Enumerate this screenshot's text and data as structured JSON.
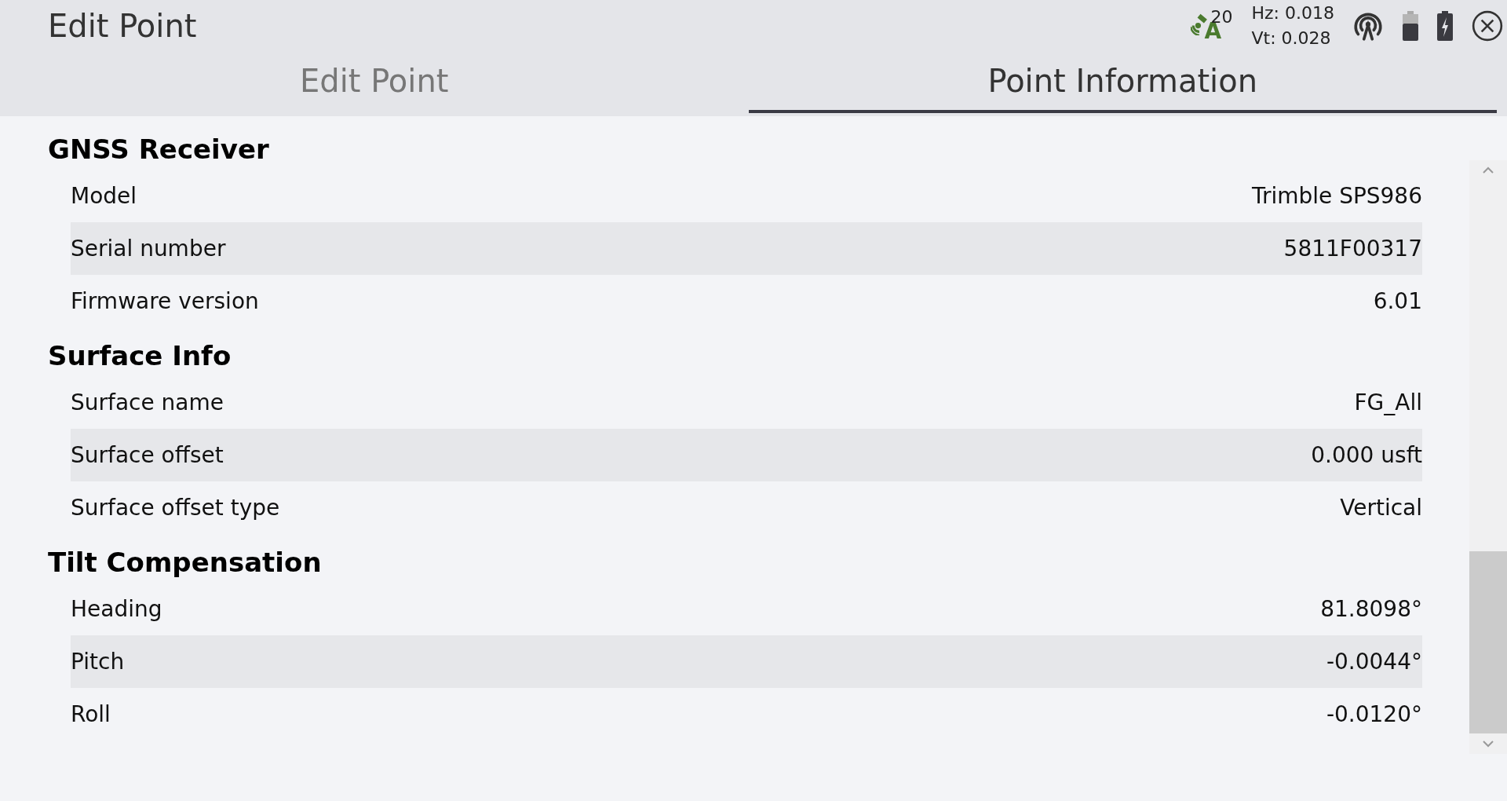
{
  "window": {
    "title": "Edit Point"
  },
  "status": {
    "satellites": "20",
    "mode": "A",
    "hz": "Hz: 0.018",
    "vt": "Vt: 0.028"
  },
  "tabs": [
    {
      "label": "Edit Point",
      "selected": false
    },
    {
      "label": "Point Information",
      "selected": true
    }
  ],
  "sections": [
    {
      "title": "GNSS Receiver",
      "rows": [
        {
          "label": "Model",
          "value": "Trimble SPS986"
        },
        {
          "label": "Serial number",
          "value": "5811F00317"
        },
        {
          "label": "Firmware version",
          "value": "6.01"
        }
      ]
    },
    {
      "title": "Surface Info",
      "rows": [
        {
          "label": "Surface name",
          "value": "FG_All"
        },
        {
          "label": "Surface offset",
          "value": "0.000 usft"
        },
        {
          "label": "Surface offset type",
          "value": "Vertical"
        }
      ]
    },
    {
      "title": "Tilt Compensation",
      "rows": [
        {
          "label": "Heading",
          "value": "81.8098°"
        },
        {
          "label": "Pitch",
          "value": "-0.0044°"
        },
        {
          "label": "Roll",
          "value": "-0.0120°"
        }
      ]
    }
  ]
}
